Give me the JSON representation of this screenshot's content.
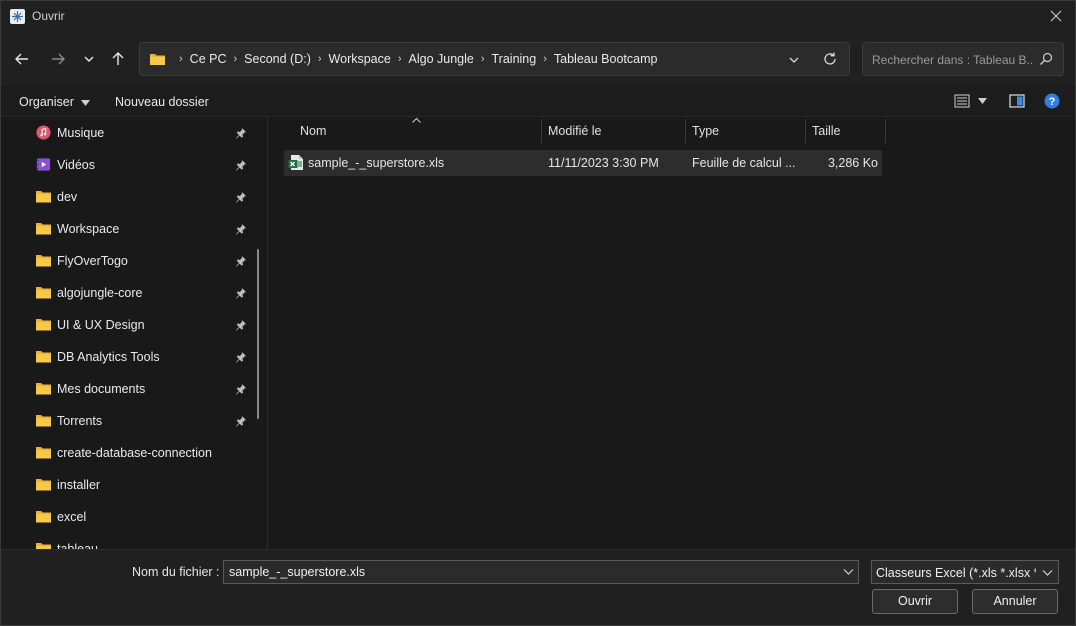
{
  "window": {
    "title": "Ouvrir",
    "close_icon": "close-icon"
  },
  "nav": {
    "breadcrumbs": [
      "Ce PC",
      "Second (D:)",
      "Workspace",
      "Algo Jungle",
      "Training",
      "Tableau Bootcamp"
    ],
    "search_placeholder": "Rechercher dans : Tableau B..."
  },
  "toolbar": {
    "organize_label": "Organiser",
    "new_folder_label": "Nouveau dossier"
  },
  "sidebar": {
    "items": [
      {
        "label": "Musique",
        "icon": "music-icon",
        "pinned": true
      },
      {
        "label": "Vidéos",
        "icon": "video-icon",
        "pinned": true
      },
      {
        "label": "dev",
        "icon": "folder-icon",
        "pinned": true
      },
      {
        "label": "Workspace",
        "icon": "folder-icon",
        "pinned": true
      },
      {
        "label": "FlyOverTogo",
        "icon": "folder-icon",
        "pinned": true
      },
      {
        "label": "algojungle-core",
        "icon": "folder-icon",
        "pinned": true
      },
      {
        "label": "UI & UX Design",
        "icon": "folder-icon",
        "pinned": true
      },
      {
        "label": "DB Analytics Tools",
        "icon": "folder-icon",
        "pinned": true
      },
      {
        "label": "Mes documents",
        "icon": "folder-icon",
        "pinned": true
      },
      {
        "label": "Torrents",
        "icon": "folder-icon",
        "pinned": true
      },
      {
        "label": "create-database-connection",
        "icon": "folder-icon",
        "pinned": false
      },
      {
        "label": "installer",
        "icon": "folder-icon",
        "pinned": false
      },
      {
        "label": "excel",
        "icon": "folder-icon",
        "pinned": false
      },
      {
        "label": "tableau",
        "icon": "folder-icon",
        "pinned": false
      }
    ]
  },
  "filelist": {
    "columns": {
      "name": "Nom",
      "modified": "Modifié le",
      "type": "Type",
      "size": "Taille"
    },
    "rows": [
      {
        "name": "sample_-_superstore.xls",
        "modified": "11/11/2023 3:30 PM",
        "type": "Feuille de calcul ...",
        "size": "3,286 Ko",
        "icon": "excel-file-icon"
      }
    ]
  },
  "footer": {
    "filename_label": "Nom du fichier :",
    "filename_value": "sample_-_superstore.xls",
    "filter_value": "Classeurs Excel (*.xls *.xlsx *.xls",
    "open_label": "Ouvrir",
    "cancel_label": "Annuler"
  },
  "colors": {
    "accent": "#3a8ee6",
    "folder": "#f4c542"
  }
}
